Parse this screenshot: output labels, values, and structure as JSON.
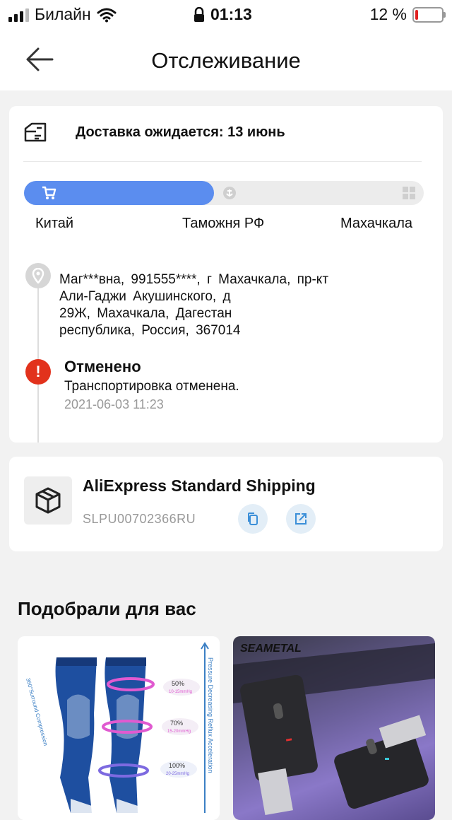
{
  "status_bar": {
    "carrier": "Билайн",
    "time": "01:13",
    "battery_text": "12 %",
    "battery_level": 0.12,
    "icons": [
      "signal-icon",
      "wifi-icon",
      "lock-icon",
      "battery-icon"
    ]
  },
  "header": {
    "title": "Отслеживание",
    "back_icon": "arrow-left-icon"
  },
  "delivery": {
    "icon": "delivery-truck-icon",
    "text": "Доставка ожидается: 13 июнь"
  },
  "progress": {
    "fraction": 0.475,
    "icons": [
      "cart-icon",
      "anchor-icon",
      "building-icon"
    ],
    "stages": [
      "Китай",
      "Таможня РФ",
      "Махачкала"
    ]
  },
  "address": {
    "icon": "location-pin-icon",
    "lines": [
      "Маг***вна, 991555****, г Махачкала, пр-кт",
      "Али-Гаджи Акушинского, д",
      "29Ж, Махачкала, Дагестан",
      "республика, Россия, 367014"
    ]
  },
  "event": {
    "icon": "exclamation-icon",
    "icon_glyph": "!",
    "title": "Отменено",
    "description": "Транспортировка отменена.",
    "time": "2021-06-03 11:23"
  },
  "shipping": {
    "icon": "package-icon",
    "name": "AliExpress Standard Shipping",
    "tracking_number": "SLPU00702366RU",
    "actions": [
      "copy-icon",
      "external-link-icon"
    ]
  },
  "recommendations": {
    "title": "Подобрали для вас",
    "products": [
      {
        "name": "compression-socks",
        "labels": [
          "50%",
          "10-15mmHg",
          "70%",
          "15-20mmHg",
          "100%",
          "20-25mmHg"
        ],
        "side_text": "360°Surround Compression",
        "vertical_text": "Pressure Decreasing Reflux Acceleration"
      },
      {
        "name": "usb-bluetooth-adapter",
        "brand": "SEAMETAL"
      }
    ]
  },
  "colors": {
    "accent_blue": "#5b8def",
    "alert_red": "#e2321c",
    "muted_gray": "#999999"
  }
}
